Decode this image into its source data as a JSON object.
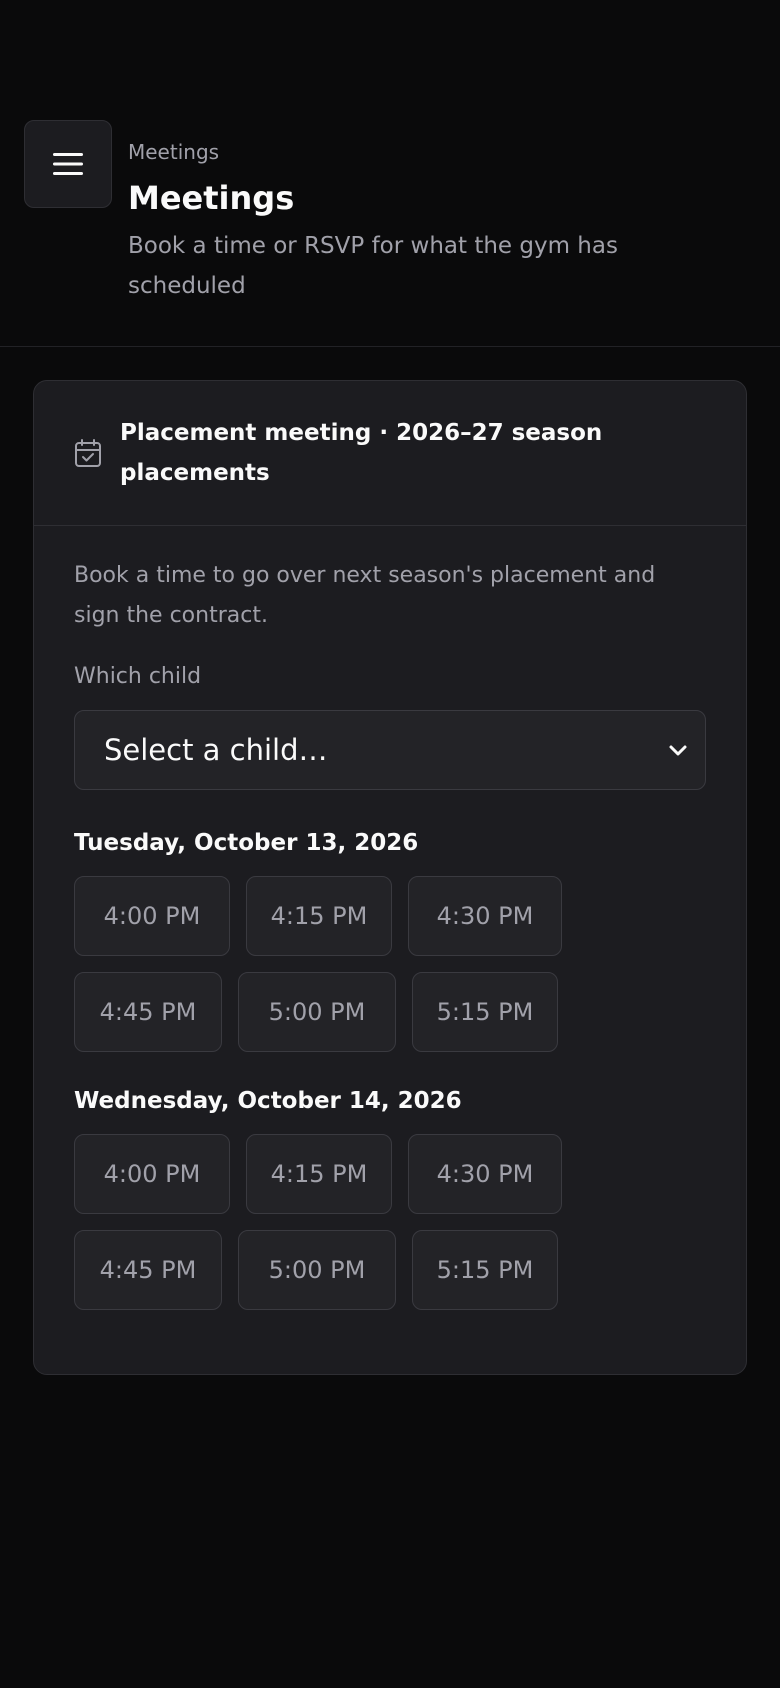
{
  "header": {
    "breadcrumb": "Meetings",
    "title": "Meetings",
    "subtitle": "Book a time or RSVP for what the gym has scheduled",
    "menu_icon": "hamburger-menu-icon"
  },
  "card": {
    "icon": "calendar-check-icon",
    "title": "Placement meeting · 2026–27 season placements",
    "description": "Book a time to go over next season's placement and sign the contract.",
    "child_label": "Which child",
    "child_select": "Select a child…",
    "days": [
      {
        "date": "Tuesday, October 13, 2026",
        "slots": [
          "4:00 PM",
          "4:15 PM",
          "4:30 PM",
          "4:45 PM",
          "5:00 PM",
          "5:15 PM"
        ]
      },
      {
        "date": "Wednesday, October 14, 2026",
        "slots": [
          "4:00 PM",
          "4:15 PM",
          "4:30 PM",
          "4:45 PM",
          "5:00 PM",
          "5:15 PM"
        ]
      }
    ]
  },
  "colors": {
    "background": "#0a0a0b",
    "card": "#1c1c20",
    "muted_text": "#a1a1aa",
    "text": "#fafafa"
  }
}
